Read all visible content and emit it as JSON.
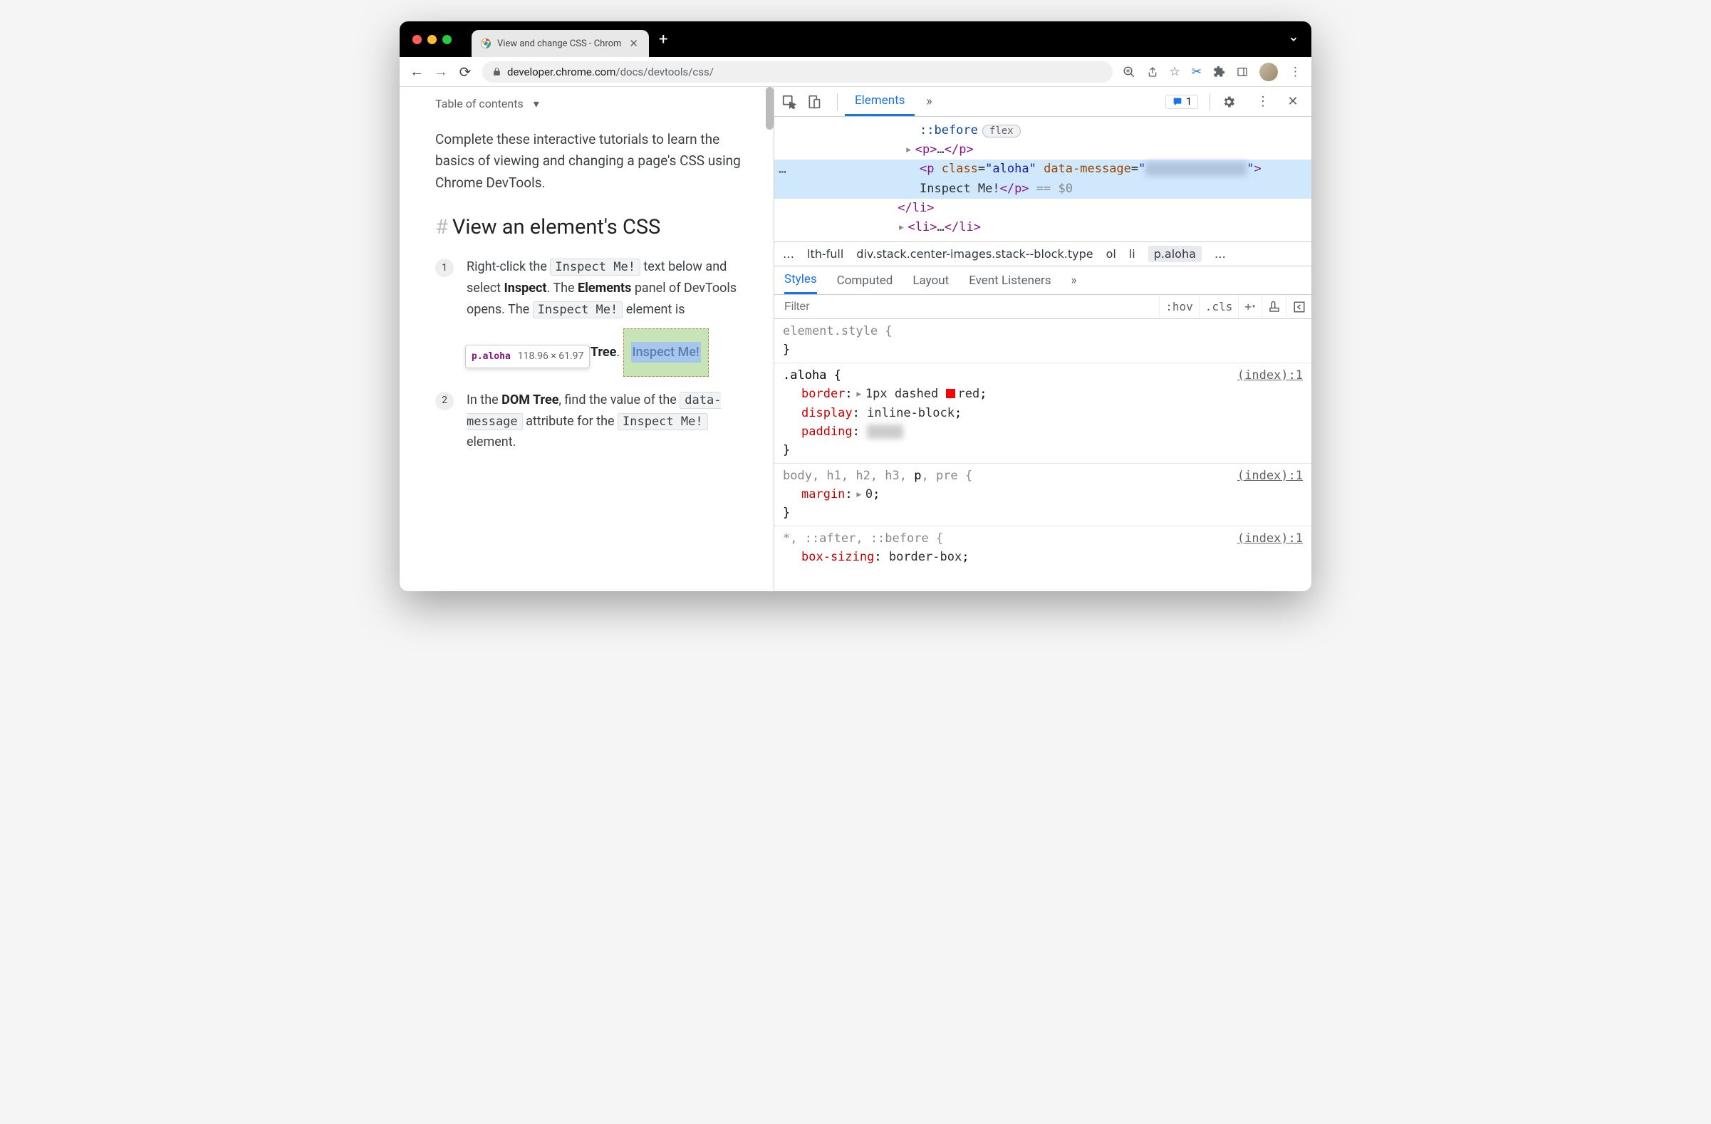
{
  "browser": {
    "tab_title": "View and change CSS - Chrom",
    "url_host": "developer.chrome.com",
    "url_path": "/docs/devtools/css/"
  },
  "page": {
    "toc_label": "Table of contents",
    "intro": "Complete these interactive tutorials to learn the basics of viewing and changing a page's CSS using Chrome DevTools.",
    "heading": "View an element's CSS",
    "step1_a": "Right-click the ",
    "step1_code1": "Inspect Me!",
    "step1_b": " text below and select ",
    "step1_bold1": "Inspect",
    "step1_c": ". The ",
    "step1_bold2": "Elements",
    "step1_d": " panel of DevTools opens. The ",
    "step1_code2": "Inspect Me!",
    "step1_e": " element is ",
    "step1_tail": "OM Tree",
    "step1_dot": ".",
    "tooltip_selector": "p.aloha",
    "tooltip_dims": "118.96 × 61.97",
    "inspect_box": "Inspect Me!",
    "step2_a": "In the ",
    "step2_bold1": "DOM Tree",
    "step2_b": ", find the value of the ",
    "step2_code1": "data-message",
    "step2_c": " attribute for the ",
    "step2_code2": "Inspect Me!",
    "step2_d": " element."
  },
  "devtools": {
    "tab_elements": "Elements",
    "issues_count": "1",
    "dom": {
      "before": "::before",
      "flex_badge": "flex",
      "p_collapsed": "<p>…</p>",
      "sel_open": "<p class=\"aloha\" data-message=\"",
      "sel_close": "\">",
      "sel_text": "Inspect Me!",
      "sel_end": "</p>",
      "sel_suffix": " == $0",
      "li_close": "</li>",
      "li_collapsed": "<li>…</li>"
    },
    "crumbs": {
      "ell": "…",
      "c1": "lth-full",
      "c2": "div.stack.center-images.stack--block.type",
      "c3": "ol",
      "c4": "li",
      "c5": "p.aloha",
      "ell2": "…"
    },
    "styles_tabs": {
      "styles": "Styles",
      "computed": "Computed",
      "layout": "Layout",
      "listeners": "Event Listeners"
    },
    "filter_placeholder": "Filter",
    "hov": ":hov",
    "cls": ".cls",
    "rules": {
      "r0_sel": "element.style {",
      "r0_close": "}",
      "r1_sel": ".aloha {",
      "r1_src": "(index):1",
      "r1_p1n": "border",
      "r1_p1v": "1px dashed ",
      "r1_p1c": "red",
      "r1_p2n": "display",
      "r1_p2v": "inline-block",
      "r1_p3n": "padding",
      "r1_close": "}",
      "r2_sel_a": "body, h1, h2, h3, ",
      "r2_sel_b": "p",
      "r2_sel_c": ", pre {",
      "r2_src": "(index):1",
      "r2_p1n": "margin",
      "r2_p1v": "0",
      "r2_close": "}",
      "r3_sel": "*, ::after, ::before {",
      "r3_src": "(index):1",
      "r3_p1n": "box-sizing",
      "r3_p1v": "border-box"
    }
  }
}
